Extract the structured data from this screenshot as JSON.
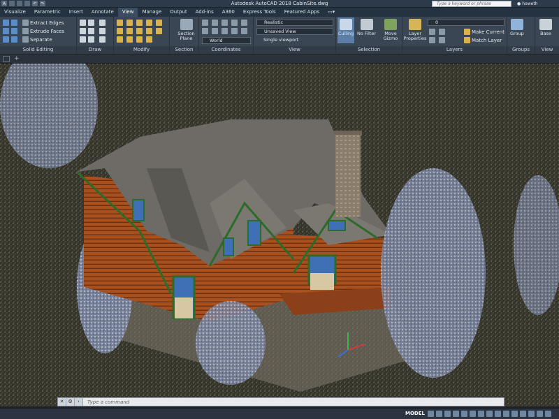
{
  "titlebar": {
    "title": "Autodesk AutoCAD 2018   CabinSite.dwg",
    "search_placeholder": "Type a keyword or phrase",
    "user": "howeth"
  },
  "ribbon_tabs": [
    "Visualize",
    "Parametric",
    "Insert",
    "Annotate",
    "View",
    "Manage",
    "Output",
    "Add-ins",
    "A360",
    "Express Tools",
    "Featured Apps"
  ],
  "ribbon_active_tab": "View",
  "panels": {
    "solid_editing": {
      "title": "Solid Editing",
      "tools": [
        "Extract Edges",
        "Extrude Faces",
        "Separate"
      ]
    },
    "draw": {
      "title": "Draw"
    },
    "modify": {
      "title": "Modify"
    },
    "section": {
      "title": "Section",
      "button": "Section Plane"
    },
    "coordinates": {
      "title": "Coordinates",
      "ucs": "World"
    },
    "view": {
      "title": "View",
      "visual_style": "Realistic",
      "named_view": "Unsaved View",
      "viewport": "Single viewport"
    },
    "selection": {
      "title": "Selection",
      "culling": "Culling",
      "filter": "No Filter",
      "gizmo": "Move Gizmo"
    },
    "layers": {
      "title": "Layers",
      "properties": "Layer Properties",
      "current_layer": "0",
      "make_current": "Make Current",
      "match_layer": "Match Layer"
    },
    "groups": {
      "title": "Groups",
      "button": "Group"
    },
    "view2": {
      "title": "View",
      "button": "Base"
    }
  },
  "command_line": {
    "placeholder": "Type a command"
  },
  "statusbar": {
    "model_label": "MODEL"
  },
  "colors": {
    "ribbon_bg": "#3b4654",
    "title_bg": "#2c3a4a",
    "log_wall": "#a44a1e",
    "roof": "#6e6b66",
    "trim": "#2d6b2a",
    "window": "#3f6fb5",
    "chimney": "#8f8070"
  }
}
